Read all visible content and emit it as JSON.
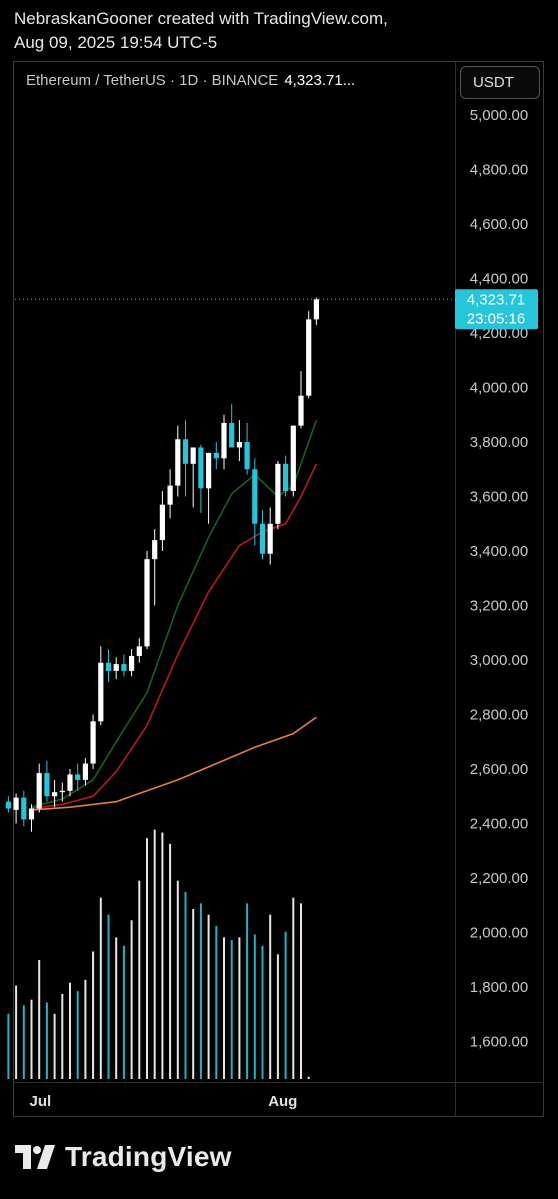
{
  "attribution": {
    "line1": "NebraskanGooner created with TradingView.com,",
    "line2": "Aug 09, 2025 19:54 UTC-5"
  },
  "legend": {
    "symbol_text": "Ethereum / TetherUS · 1D · BINANCE",
    "price_text": "4,323.71..."
  },
  "currency_button": "USDT",
  "price_label": {
    "price": "4,323.71",
    "countdown": "23:05:16"
  },
  "brand": {
    "name": "TradingView"
  },
  "colors": {
    "up_candle": "#ffffff",
    "down_candle": "#26c6da",
    "ema_short": "#1b5e20",
    "ema_mid": "#b71c1c",
    "ema_long": "#e67e3c",
    "price_tag_bg": "#26c6da",
    "background": "#000000"
  },
  "chart_data": {
    "type": "candlestick",
    "symbol": "ETHUSDT",
    "exchange": "BINANCE",
    "timeframe": "1D",
    "y_axis": {
      "ticks": [
        5000,
        4800,
        4600,
        4400,
        4200,
        4000,
        3800,
        3600,
        3400,
        3200,
        3000,
        2800,
        2600,
        2400,
        2200,
        2000,
        1800,
        1600
      ],
      "tick_labels": [
        "5,000.00",
        "4,800.00",
        "4,600.00",
        "4,400.00",
        "4,200.00",
        "4,000.00",
        "3,800.00",
        "3,600.00",
        "3,400.00",
        "3,200.00",
        "3,000.00",
        "2,800.00",
        "2,600.00",
        "2,400.00",
        "2,200.00",
        "2,000.00",
        "1,800.00",
        "1,600.00"
      ],
      "range": [
        1450,
        5080
      ]
    },
    "x_axis": {
      "labels": [
        {
          "text": "Jul",
          "day": 1
        },
        {
          "text": "Aug",
          "day": 32
        }
      ]
    },
    "last_price": 4323.71,
    "candles": [
      {
        "day": -2,
        "o": 2480,
        "h": 2500,
        "l": 2440,
        "c": 2455
      },
      {
        "day": -1,
        "o": 2450,
        "h": 2510,
        "l": 2400,
        "c": 2495
      },
      {
        "day": 0,
        "o": 2495,
        "h": 2520,
        "l": 2390,
        "c": 2415
      },
      {
        "day": 1,
        "o": 2415,
        "h": 2470,
        "l": 2370,
        "c": 2455
      },
      {
        "day": 2,
        "o": 2455,
        "h": 2620,
        "l": 2440,
        "c": 2585
      },
      {
        "day": 3,
        "o": 2585,
        "h": 2630,
        "l": 2480,
        "c": 2500
      },
      {
        "day": 4,
        "o": 2500,
        "h": 2560,
        "l": 2460,
        "c": 2515
      },
      {
        "day": 5,
        "o": 2515,
        "h": 2550,
        "l": 2480,
        "c": 2520
      },
      {
        "day": 6,
        "o": 2520,
        "h": 2600,
        "l": 2500,
        "c": 2580
      },
      {
        "day": 7,
        "o": 2580,
        "h": 2620,
        "l": 2520,
        "c": 2560
      },
      {
        "day": 8,
        "o": 2560,
        "h": 2640,
        "l": 2540,
        "c": 2620
      },
      {
        "day": 9,
        "o": 2620,
        "h": 2800,
        "l": 2600,
        "c": 2775
      },
      {
        "day": 10,
        "o": 2775,
        "h": 3050,
        "l": 2760,
        "c": 2990
      },
      {
        "day": 11,
        "o": 2990,
        "h": 3040,
        "l": 2920,
        "c": 2960
      },
      {
        "day": 12,
        "o": 2960,
        "h": 3010,
        "l": 2930,
        "c": 2985
      },
      {
        "day": 13,
        "o": 2985,
        "h": 3020,
        "l": 2940,
        "c": 2960
      },
      {
        "day": 14,
        "o": 2960,
        "h": 3040,
        "l": 2940,
        "c": 3015
      },
      {
        "day": 15,
        "o": 3015,
        "h": 3080,
        "l": 2990,
        "c": 3050
      },
      {
        "day": 16,
        "o": 3050,
        "h": 3400,
        "l": 3040,
        "c": 3370
      },
      {
        "day": 17,
        "o": 3370,
        "h": 3480,
        "l": 3200,
        "c": 3440
      },
      {
        "day": 18,
        "o": 3440,
        "h": 3620,
        "l": 3400,
        "c": 3570
      },
      {
        "day": 19,
        "o": 3570,
        "h": 3700,
        "l": 3520,
        "c": 3640
      },
      {
        "day": 20,
        "o": 3640,
        "h": 3860,
        "l": 3600,
        "c": 3810
      },
      {
        "day": 21,
        "o": 3810,
        "h": 3880,
        "l": 3600,
        "c": 3720
      },
      {
        "day": 22,
        "o": 3720,
        "h": 3780,
        "l": 3560,
        "c": 3780
      },
      {
        "day": 23,
        "o": 3780,
        "h": 3790,
        "l": 3540,
        "c": 3630
      },
      {
        "day": 24,
        "o": 3630,
        "h": 3760,
        "l": 3500,
        "c": 3760
      },
      {
        "day": 25,
        "o": 3760,
        "h": 3800,
        "l": 3700,
        "c": 3740
      },
      {
        "day": 26,
        "o": 3740,
        "h": 3900,
        "l": 3700,
        "c": 3870
      },
      {
        "day": 27,
        "o": 3870,
        "h": 3940,
        "l": 3780,
        "c": 3780
      },
      {
        "day": 28,
        "o": 3780,
        "h": 3880,
        "l": 3730,
        "c": 3800
      },
      {
        "day": 29,
        "o": 3800,
        "h": 3870,
        "l": 3680,
        "c": 3700
      },
      {
        "day": 30,
        "o": 3700,
        "h": 3740,
        "l": 3420,
        "c": 3500
      },
      {
        "day": 31,
        "o": 3500,
        "h": 3550,
        "l": 3370,
        "c": 3390
      },
      {
        "day": 32,
        "o": 3390,
        "h": 3560,
        "l": 3350,
        "c": 3500
      },
      {
        "day": 33,
        "o": 3500,
        "h": 3730,
        "l": 3480,
        "c": 3720
      },
      {
        "day": 34,
        "o": 3720,
        "h": 3750,
        "l": 3600,
        "c": 3620
      },
      {
        "day": 35,
        "o": 3620,
        "h": 3860,
        "l": 3600,
        "c": 3860
      },
      {
        "day": 36,
        "o": 3860,
        "h": 4060,
        "l": 3850,
        "c": 3970
      },
      {
        "day": 37,
        "o": 3970,
        "h": 4280,
        "l": 3960,
        "c": 4250
      },
      {
        "day": 38,
        "o": 4250,
        "h": 4330,
        "l": 4230,
        "c": 4323.71
      }
    ],
    "volume": [
      230,
      330,
      260,
      280,
      420,
      270,
      230,
      300,
      340,
      310,
      350,
      450,
      640,
      580,
      500,
      470,
      560,
      700,
      850,
      880,
      870,
      830,
      700,
      660,
      600,
      620,
      580,
      540,
      500,
      490,
      500,
      620,
      510,
      470,
      580,
      440,
      520,
      640,
      620,
      8
    ],
    "volume_axis_max": 900,
    "ema_short": [
      {
        "day": 1,
        "v": 2460
      },
      {
        "day": 5,
        "v": 2490
      },
      {
        "day": 9,
        "v": 2560
      },
      {
        "day": 12,
        "v": 2700
      },
      {
        "day": 16,
        "v": 2880
      },
      {
        "day": 20,
        "v": 3200
      },
      {
        "day": 24,
        "v": 3450
      },
      {
        "day": 27,
        "v": 3610
      },
      {
        "day": 30,
        "v": 3680
      },
      {
        "day": 33,
        "v": 3600
      },
      {
        "day": 35,
        "v": 3640
      },
      {
        "day": 38,
        "v": 3880
      }
    ],
    "ema_mid": [
      {
        "day": 1,
        "v": 2455
      },
      {
        "day": 5,
        "v": 2470
      },
      {
        "day": 9,
        "v": 2500
      },
      {
        "day": 12,
        "v": 2590
      },
      {
        "day": 16,
        "v": 2760
      },
      {
        "day": 20,
        "v": 3020
      },
      {
        "day": 24,
        "v": 3250
      },
      {
        "day": 28,
        "v": 3420
      },
      {
        "day": 31,
        "v": 3470
      },
      {
        "day": 34,
        "v": 3500
      },
      {
        "day": 36,
        "v": 3600
      },
      {
        "day": 38,
        "v": 3720
      }
    ],
    "ema_long": [
      {
        "day": 1,
        "v": 2450
      },
      {
        "day": 6,
        "v": 2460
      },
      {
        "day": 12,
        "v": 2480
      },
      {
        "day": 16,
        "v": 2520
      },
      {
        "day": 20,
        "v": 2560
      },
      {
        "day": 25,
        "v": 2620
      },
      {
        "day": 30,
        "v": 2680
      },
      {
        "day": 35,
        "v": 2730
      },
      {
        "day": 38,
        "v": 2790
      }
    ],
    "grid": false,
    "legend_position": "top-left"
  }
}
